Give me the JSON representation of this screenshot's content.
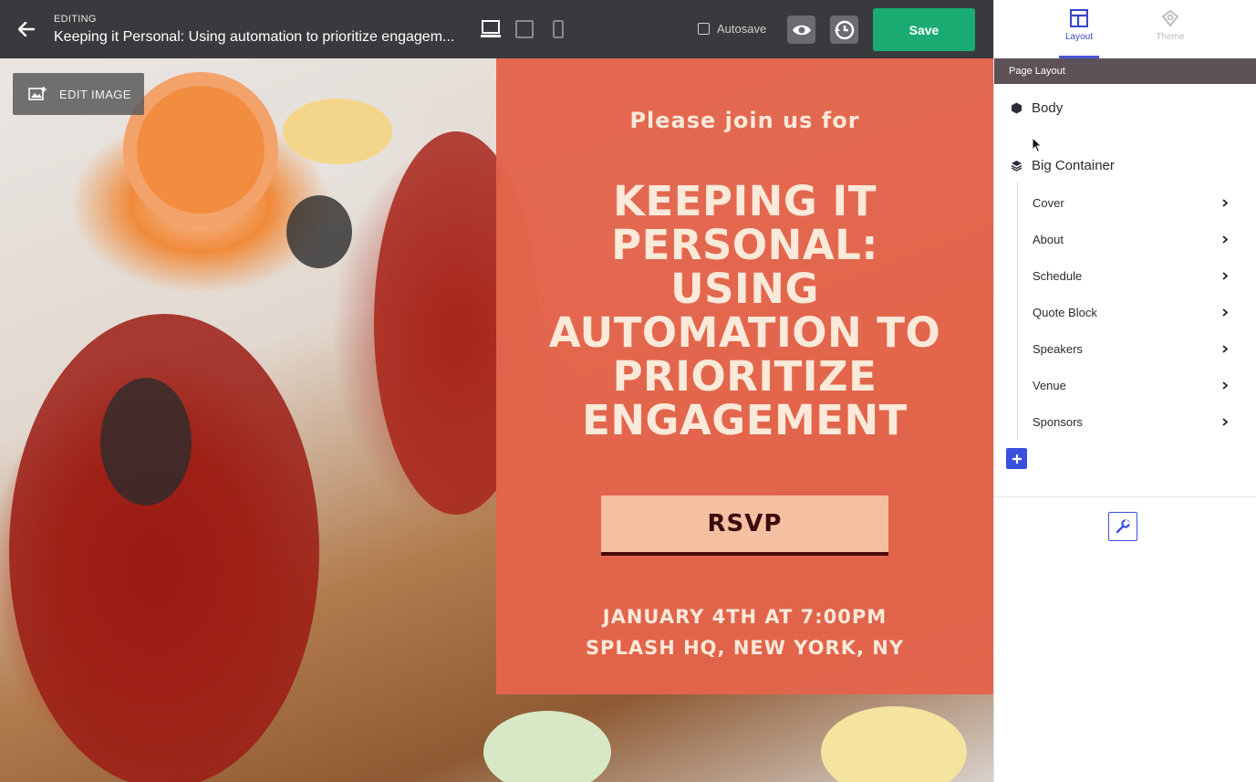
{
  "topbar": {
    "editing_label": "EDITING",
    "title": "Keeping it Personal: Using automation to prioritize engagem...",
    "autosave_label": "Autosave",
    "save_label": "Save"
  },
  "canvas": {
    "edit_image_label": "EDIT IMAGE",
    "hero": {
      "pre_title": "Please join us for",
      "headline": "KEEPING IT PERSONAL: USING AUTOMATION TO PRIORITIZE ENGAGEMENT",
      "rsvp_label": "RSVP",
      "date": "JANUARY 4TH AT 7:00PM",
      "venue": "SPLASH HQ, NEW YORK, NY"
    }
  },
  "panel": {
    "tabs": [
      {
        "label": "Layout",
        "icon": "layout-icon",
        "active": true
      },
      {
        "label": "Theme",
        "icon": "theme-icon",
        "active": false
      }
    ],
    "section_title": "Page Layout",
    "body_label": "Body",
    "container_label": "Big Container",
    "children": [
      {
        "label": "Cover"
      },
      {
        "label": "About"
      },
      {
        "label": "Schedule"
      },
      {
        "label": "Quote Block"
      },
      {
        "label": "Speakers"
      },
      {
        "label": "Venue"
      },
      {
        "label": "Sponsors"
      }
    ]
  },
  "colors": {
    "accent": "#3a4fe0",
    "save": "#1aab73",
    "hero": "#e3644b",
    "topbar": "#393a3d"
  }
}
